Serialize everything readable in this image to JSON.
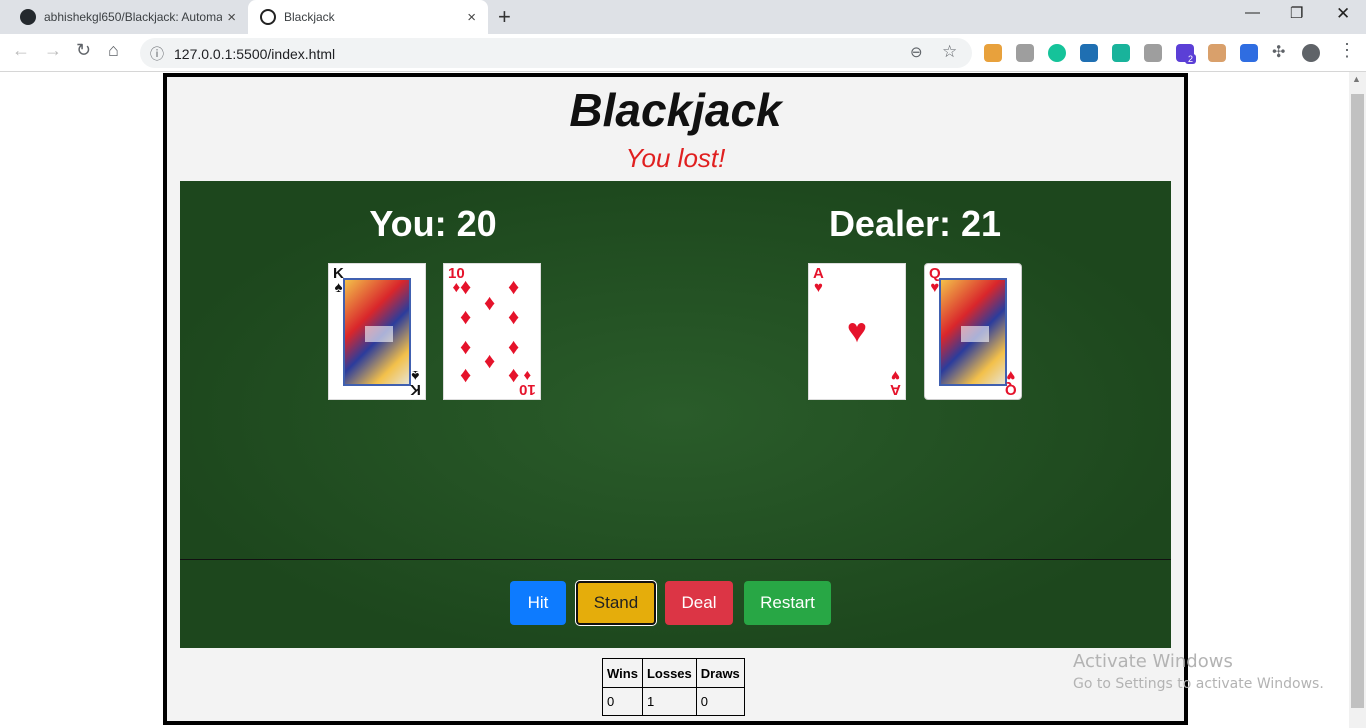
{
  "browser": {
    "tabs": [
      {
        "title": "abhishekgl650/Blackjack: Automa",
        "close": "×",
        "favicon": "github-icon"
      },
      {
        "title": "Blackjack",
        "close": "×",
        "favicon": "blackjack-favicon"
      }
    ],
    "new_tab": "+",
    "window_controls": {
      "minimize": "—",
      "maximize": "❐",
      "close": "✕"
    },
    "nav": {
      "back": "←",
      "forward": "→",
      "reload": "↻",
      "home": "⌂"
    },
    "url": "127.0.0.1:5500/index.html",
    "info_icon": "ⓘ",
    "zoom_icon": "⊖",
    "star_icon": "☆",
    "extension_badge": "2",
    "extensions_icon": "✣",
    "menu_icon": "⋮",
    "extension_colors": [
      "#e8a13c",
      "#9e9e9e",
      "#15c39a",
      "#1f6fb2",
      "#19b39b",
      "#9e9e9e",
      "#5b3fd6",
      "#d9a06b",
      "#2f6de1"
    ]
  },
  "game": {
    "title": "Blackjack",
    "result": "You lost!",
    "player": {
      "label": "You: 20",
      "cards": [
        {
          "rank": "K",
          "suit": "♠",
          "color": "black"
        },
        {
          "rank": "10",
          "suit": "♦",
          "color": "red"
        }
      ]
    },
    "dealer": {
      "label": "Dealer: 21",
      "cards": [
        {
          "rank": "A",
          "suit": "♥",
          "color": "red"
        },
        {
          "rank": "Q",
          "suit": "♥",
          "color": "red"
        }
      ]
    },
    "buttons": {
      "hit": "Hit",
      "stand": "Stand",
      "deal": "Deal",
      "restart": "Restart"
    },
    "score": {
      "headers": [
        "Wins",
        "Losses",
        "Draws"
      ],
      "values": [
        "0",
        "1",
        "0"
      ]
    }
  },
  "scrollbar": {
    "up_arrow": "▲"
  },
  "watermark": {
    "line1": "Activate Windows",
    "line2": "Go to Settings to activate Windows."
  }
}
